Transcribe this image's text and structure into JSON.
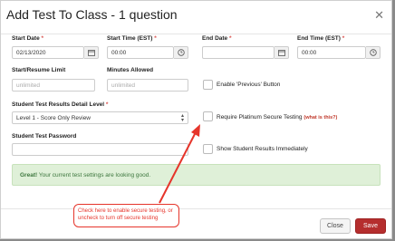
{
  "modal": {
    "title": "Add Test To Class - 1 question",
    "close_icon": "close-icon"
  },
  "fields": {
    "start_date": {
      "label": "Start Date",
      "required_mark": "*",
      "value": "02/13/2020",
      "icon": "calendar-icon"
    },
    "start_time": {
      "label": "Start Time (EST)",
      "required_mark": "*",
      "value": "00:00",
      "icon": "clock-icon"
    },
    "end_date": {
      "label": "End Date",
      "required_mark": "*",
      "value": "",
      "icon": "calendar-icon"
    },
    "end_time": {
      "label": "End Time (EST)",
      "required_mark": "*",
      "value": "00:00",
      "icon": "clock-icon"
    },
    "resume_limit": {
      "label": "Start/Resume Limit",
      "placeholder": "unlimited"
    },
    "minutes_allowed": {
      "label": "Minutes Allowed",
      "placeholder": "unlimited"
    },
    "detail_level": {
      "label": "Student Test Results Detail Level",
      "required_mark": "*",
      "value": "Level 1 - Score Only Review"
    },
    "password": {
      "label": "Student Test Password",
      "value": ""
    }
  },
  "checkboxes": {
    "enable_previous": {
      "label": "Enable 'Previous' Button",
      "checked": false
    },
    "platinum_secure": {
      "label": "Require Platinum Secure Testing",
      "help_link": "(what is this?)",
      "checked": false
    },
    "show_results": {
      "label": "Show Student Results Immediately",
      "checked": false
    }
  },
  "alert": {
    "strong": "Great!",
    "message": " Your current test settings are looking good."
  },
  "callout": {
    "text": "Check here to enable secure testing, or uncheck to turn off secure testing"
  },
  "buttons": {
    "close_label": "Close",
    "save_label": "Save"
  },
  "colors": {
    "save": "#b52e2e",
    "annotation": "#e6352b",
    "success_bg": "#dff0d8",
    "required": "#d9534f"
  }
}
